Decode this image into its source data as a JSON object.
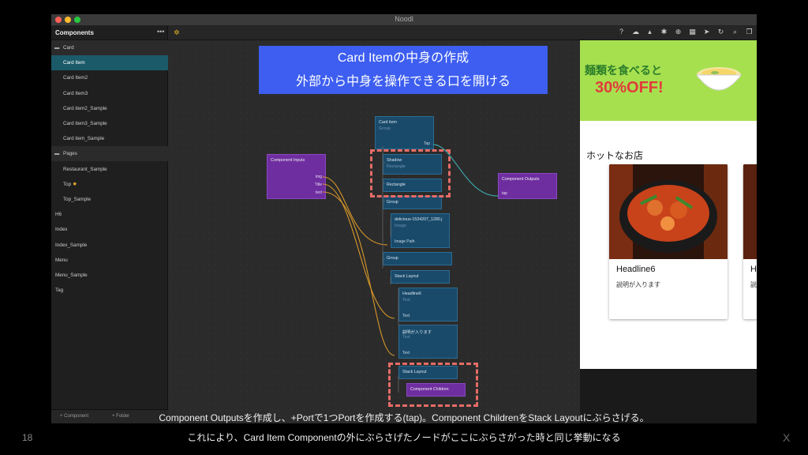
{
  "window": {
    "title": "Noodl"
  },
  "sidebar": {
    "title": "Components",
    "more_label": "•••",
    "items": [
      {
        "label": "Card",
        "kind": "folder"
      },
      {
        "label": "Card Item",
        "kind": "child",
        "selected": true
      },
      {
        "label": "Card Item2",
        "kind": "child"
      },
      {
        "label": "Card Item3",
        "kind": "child"
      },
      {
        "label": "Card item2_Sample",
        "kind": "child"
      },
      {
        "label": "Card item3_Sample",
        "kind": "child"
      },
      {
        "label": "Card item_Sample",
        "kind": "child"
      },
      {
        "label": "Pages",
        "kind": "folder"
      },
      {
        "label": "Restaurant_Sample",
        "kind": "child"
      },
      {
        "label": "Top",
        "kind": "child",
        "home": true
      },
      {
        "label": "Top_Sample",
        "kind": "child"
      },
      {
        "label": "H6",
        "kind": "root"
      },
      {
        "label": "Index",
        "kind": "root"
      },
      {
        "label": "Index_Sample",
        "kind": "root"
      },
      {
        "label": "Menu",
        "kind": "root"
      },
      {
        "label": "Menu_Sample",
        "kind": "root"
      },
      {
        "label": "Tag",
        "kind": "root"
      }
    ],
    "footer": {
      "add_component": "+ Component",
      "add_folder": "+ Folder"
    }
  },
  "toolbar": {
    "left_icon": "bug-icon",
    "right_icons": [
      "help-icon",
      "cloud-icon",
      "deploy-icon",
      "debug-icon",
      "upload-icon",
      "grid-icon",
      "send-icon",
      "refresh-icon",
      "search-icon",
      "window-icon"
    ]
  },
  "nodes": {
    "card_item": {
      "title": "Card item",
      "sub": "Group",
      "port": "Tap"
    },
    "component_inputs": {
      "title": "Component Inputs",
      "ports": [
        "img",
        "Title",
        "text"
      ]
    },
    "shadow": {
      "title": "Shadow",
      "sub": "Rectangle"
    },
    "rectangle": {
      "title": "Rectangle"
    },
    "group1": {
      "title": "Group"
    },
    "image": {
      "title": "delicious-1534207_1280.j",
      "sub": "Image",
      "port": "Image Path"
    },
    "group2": {
      "title": "Group"
    },
    "stack_layout1": {
      "title": "Stack Layout"
    },
    "headline6": {
      "title": "Headline6",
      "sub": "Text",
      "port": "Text"
    },
    "desc": {
      "title": "説明が入ります",
      "sub": "Text",
      "port": "Text"
    },
    "stack_layout2": {
      "title": "Stack Layout"
    },
    "component_children": {
      "title": "Component Children"
    },
    "component_outputs": {
      "title": "Component Outputs",
      "port": "tap"
    }
  },
  "preview": {
    "banner_line1": "麺類を食べると",
    "banner_line2": "30%OFF!",
    "shop_title": "ホットなお店",
    "card1": {
      "headline": "Headline6",
      "desc": "説明が入ります"
    },
    "card2": {
      "headline": "H",
      "desc": "説"
    }
  },
  "callout": {
    "line1": "Card Itemの中身の作成",
    "line2": "外部から中身を操作できる口を開ける"
  },
  "captions": {
    "line1": "Component Outputsを作成し、+Portで1つPortを作成する(tap)。Component ChildrenをStack Layoutにぶらさげる。",
    "line2": "これにより、Card Item Componentの外にぶらさげたノードがここにぶらさがった時と同じ挙動になる"
  },
  "slide_number": "18",
  "corner_mark": "X",
  "colors": {
    "node_blue": "#1a4a6a",
    "node_purple": "#6f2ea0",
    "wire_orange": "#d9982a",
    "wire_teal": "#3ea3a8",
    "highlight": "#e76c67",
    "callout": "#3d5ef0",
    "banner": "#a7e04f"
  }
}
